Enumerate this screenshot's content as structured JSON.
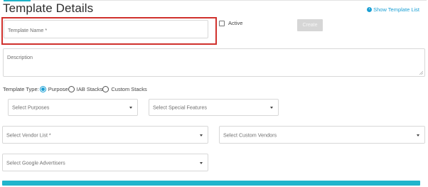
{
  "header": {
    "title": "Template Details",
    "show_list_label": "Show Template List"
  },
  "form": {
    "template_name": {
      "placeholder": "Template Name *",
      "value": ""
    },
    "active": {
      "label": "Active",
      "checked": false
    },
    "create_label": "Create",
    "description": {
      "placeholder": "Description",
      "value": ""
    },
    "template_type": {
      "label": "Template Type",
      "options": [
        {
          "label": "Purpose",
          "selected": true
        },
        {
          "label": "IAB Stacks",
          "selected": false
        },
        {
          "label": "Custom Stacks",
          "selected": false
        }
      ]
    },
    "select_purposes": "Select Purposes",
    "select_special_features": "Select Special Features",
    "select_vendor_list": "Select Vendor List *",
    "select_custom_vendors": "Select Custom Vendors",
    "select_google_advertisers": "Select Google Advertisers"
  },
  "icons": {
    "show_list": "chevron-left-circle-icon",
    "dropdown": "caret-down-icon",
    "resize": "resize-handle-icon"
  },
  "colors": {
    "accent": "#1fb3c9",
    "link": "#1a9fd4",
    "highlight": "#d0312d",
    "disabled_button": "#d6d6d6"
  }
}
